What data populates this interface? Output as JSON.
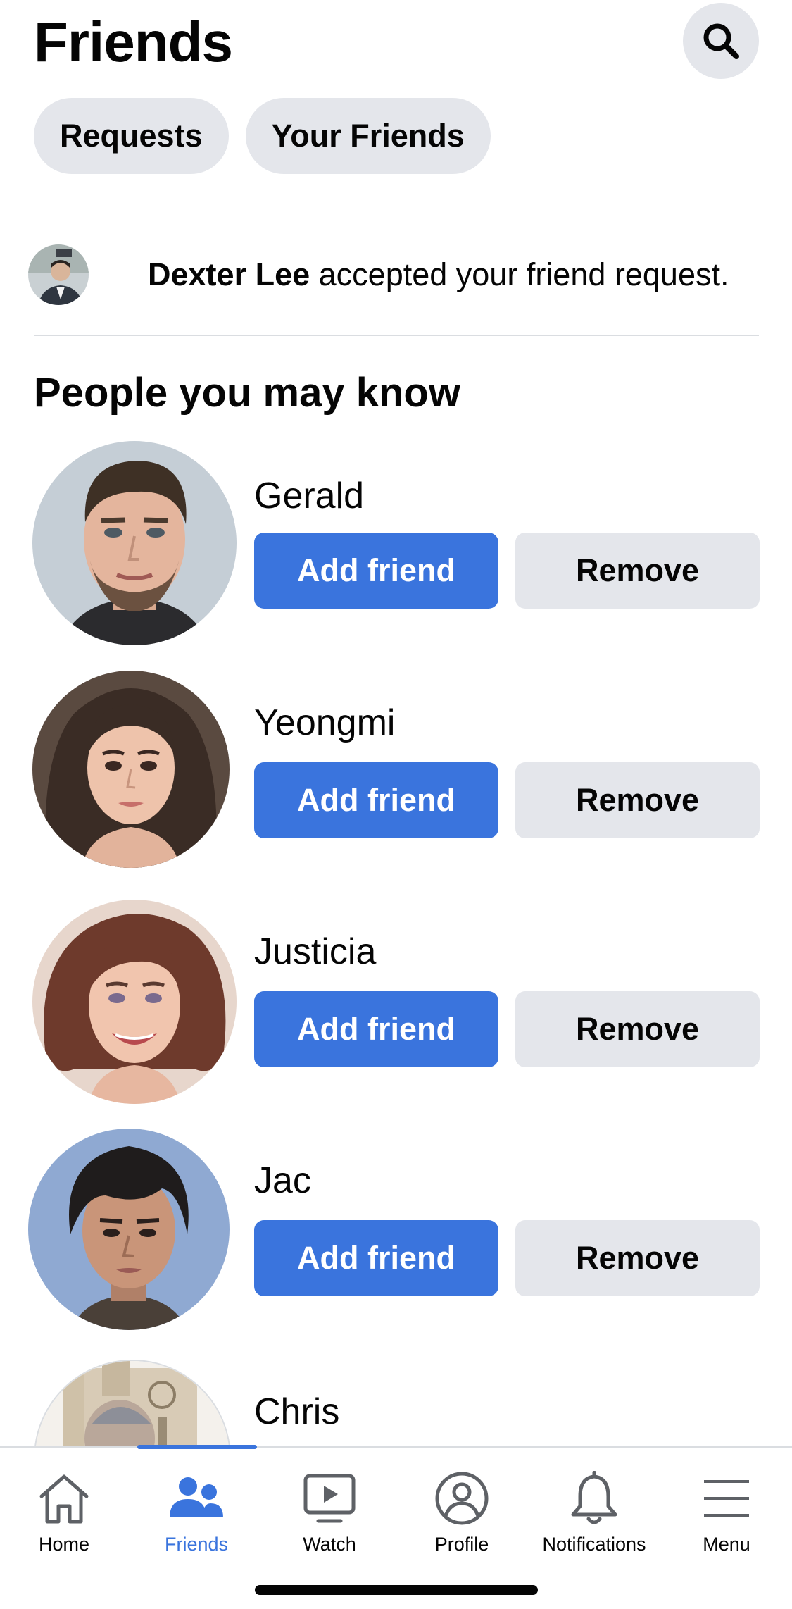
{
  "header": {
    "title": "Friends"
  },
  "chips": [
    {
      "label": "Requests"
    },
    {
      "label": "Your Friends"
    }
  ],
  "notification": {
    "name": "Dexter Lee",
    "message": "accepted your friend request."
  },
  "suggestions": {
    "title": "People you may know",
    "people": [
      {
        "name": "Gerald",
        "add_label": "Add friend",
        "remove_label": "Remove"
      },
      {
        "name": "Yeongmi",
        "add_label": "Add friend",
        "remove_label": "Remove"
      },
      {
        "name": "Justicia",
        "add_label": "Add friend",
        "remove_label": "Remove"
      },
      {
        "name": "Jac",
        "add_label": "Add friend",
        "remove_label": "Remove"
      },
      {
        "name": "Chris"
      }
    ]
  },
  "tabbar": {
    "active": "Friends",
    "tabs": [
      {
        "label": "Home",
        "icon": "home-icon"
      },
      {
        "label": "Friends",
        "icon": "friends-icon"
      },
      {
        "label": "Watch",
        "icon": "watch-icon"
      },
      {
        "label": "Profile",
        "icon": "profile-icon"
      },
      {
        "label": "Notifications",
        "icon": "bell-icon"
      },
      {
        "label": "Menu",
        "icon": "hamburger-icon"
      }
    ]
  },
  "colors": {
    "accent": "#3a74dd",
    "chip_bg": "#e4e6eb",
    "text": "#050505"
  }
}
